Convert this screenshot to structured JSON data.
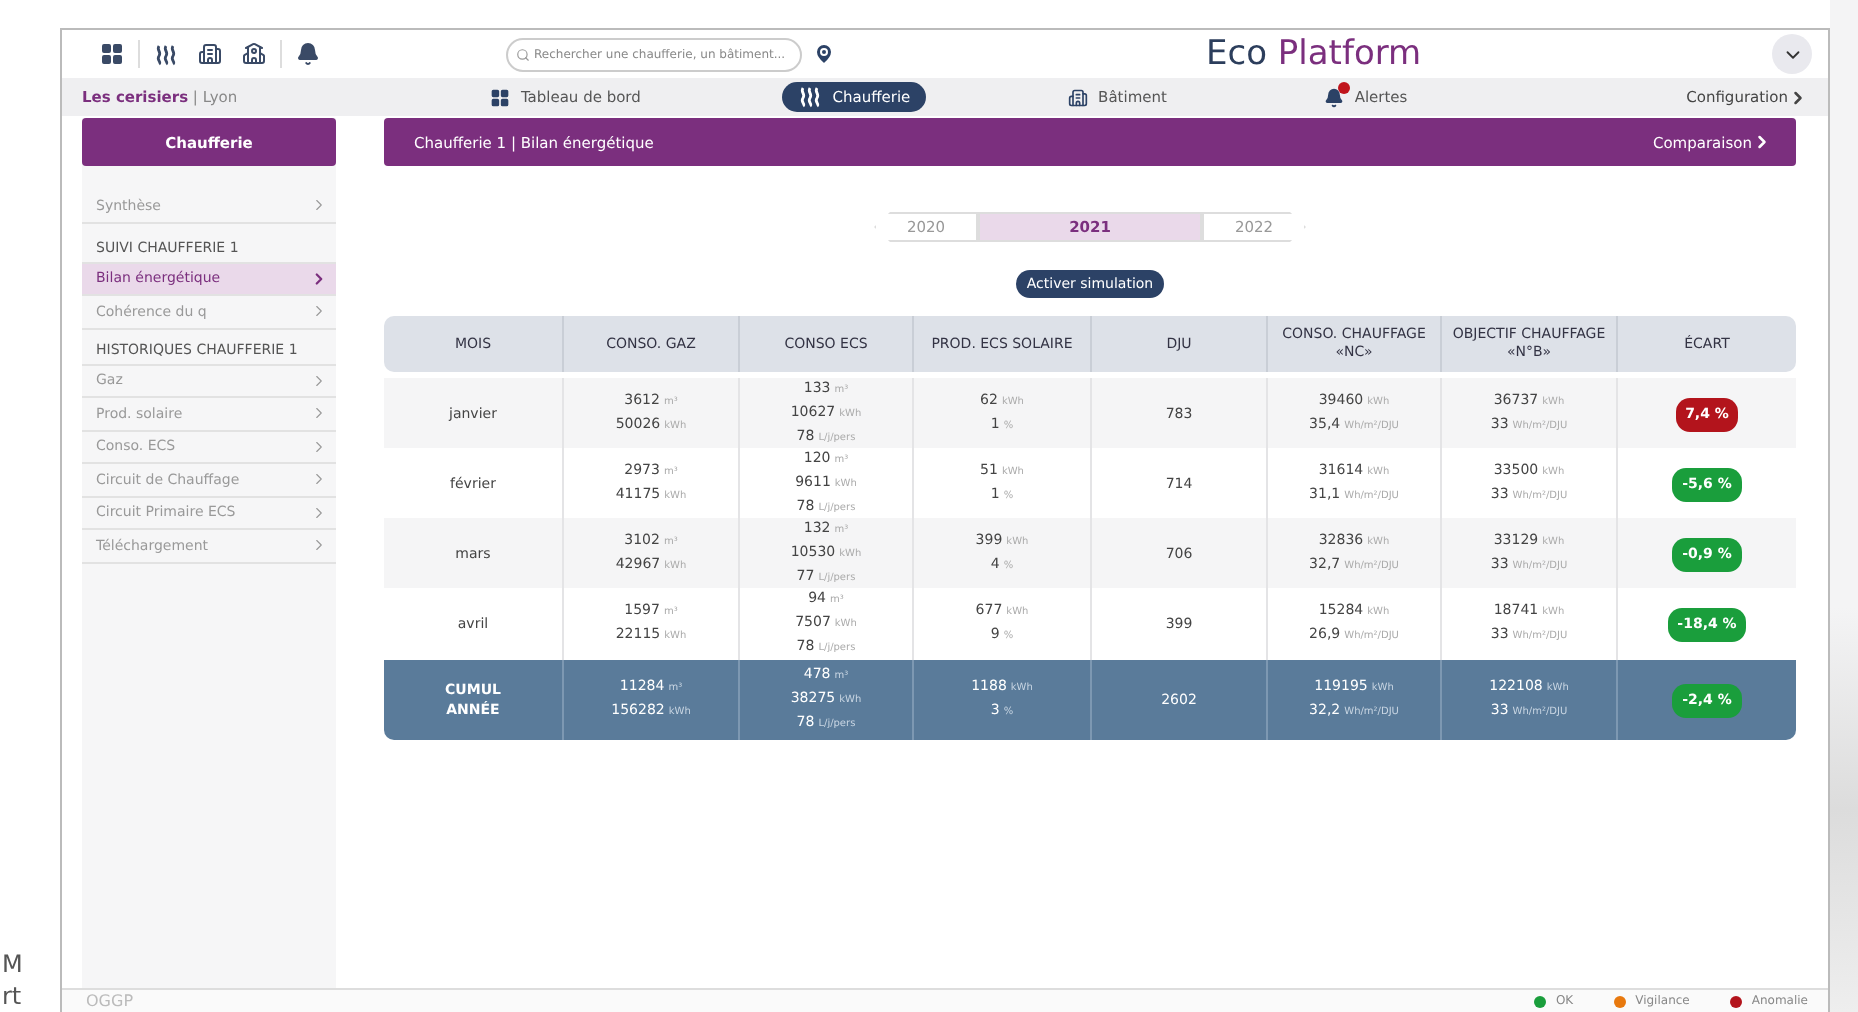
{
  "edge_texts": [
    "M",
    "rt"
  ],
  "header": {
    "search": {
      "placeholder": "Rechercher une chaufferie, un bâtiment..."
    },
    "logo": {
      "part1": "Eco",
      "part2": "Platform"
    }
  },
  "location": "**Les cerisiers** | Lyon",
  "nav": [
    {
      "label": "Tableau de bord",
      "selected": false
    },
    {
      "label": "Chaufferie",
      "selected": true
    },
    {
      "label": "Bâtiment",
      "selected": false
    },
    {
      "label": "Alertes",
      "selected": false
    }
  ],
  "config_link": "Configuration",
  "sidebar": {
    "title": "Chaufferie",
    "items": [
      {
        "kind": "link",
        "label": "Synthèse",
        "selected": false
      },
      {
        "kind": "section",
        "label": "SUIVI CHAUFFERIE 1"
      },
      {
        "kind": "link",
        "label": "Bilan énergétique",
        "selected": true
      },
      {
        "kind": "link",
        "label": "Cohérence du q",
        "selected": false
      },
      {
        "kind": "section",
        "label": "HISTORIQUES CHAUFFERIE 1"
      },
      {
        "kind": "link",
        "label": "Gaz",
        "selected": false
      },
      {
        "kind": "link",
        "label": "Prod. solaire",
        "selected": false
      },
      {
        "kind": "link",
        "label": "Conso. ECS",
        "selected": false
      },
      {
        "kind": "link",
        "label": "Circuit de Chauffage",
        "selected": false
      },
      {
        "kind": "link",
        "label": "Circuit Primaire ECS",
        "selected": false
      },
      {
        "kind": "link",
        "label": "Téléchargement",
        "selected": false
      }
    ]
  },
  "page_title": "Chaufferie 1 | Bilan énergétique",
  "compare_link": "Comparaison",
  "years": [
    {
      "label": "2020",
      "selected": false
    },
    {
      "label": "2021",
      "selected": true
    },
    {
      "label": "2022",
      "selected": false
    }
  ],
  "simulation_button": "Activer simulation",
  "table": {
    "columns": [
      "MOIS",
      "CONSO. GAZ",
      "CONSO ECS",
      "PROD. ECS SOLAIRE",
      "DJU",
      "CONSO. CHAUFFAGE «NC»",
      "OBJECTIF CHAUFFAGE «N°B»",
      "ÉCART"
    ],
    "rows": [
      {
        "kind": "month",
        "color": "#b3141c",
        "cells": [
          [
            [
              "janvier",
              ""
            ]
          ],
          [
            [
              "3612",
              "m³"
            ],
            [
              "50026",
              "kWh"
            ]
          ],
          [
            [
              "133",
              "m³"
            ],
            [
              "10627",
              "kWh"
            ],
            [
              "78",
              "L/j/pers"
            ]
          ],
          [
            [
              "62",
              "kWh"
            ],
            [
              "1",
              "%"
            ]
          ],
          [
            [
              "783",
              ""
            ]
          ],
          [
            [
              "39460",
              "kWh"
            ],
            [
              "35,4",
              "Wh/m²/DJU"
            ]
          ],
          [
            [
              "36737",
              "kWh"
            ],
            [
              "33",
              "Wh/m²/DJU"
            ]
          ],
          [
            [
              "7,4 %",
              ""
            ]
          ]
        ]
      },
      {
        "kind": "month",
        "color": "#1a9e3c",
        "cells": [
          [
            [
              "février",
              ""
            ]
          ],
          [
            [
              "2973",
              "m³"
            ],
            [
              "41175",
              "kWh"
            ]
          ],
          [
            [
              "120",
              "m³"
            ],
            [
              "9611",
              "kWh"
            ],
            [
              "78",
              "L/j/pers"
            ]
          ],
          [
            [
              "51",
              "kWh"
            ],
            [
              "1",
              "%"
            ]
          ],
          [
            [
              "714",
              ""
            ]
          ],
          [
            [
              "31614",
              "kWh"
            ],
            [
              "31,1",
              "Wh/m²/DJU"
            ]
          ],
          [
            [
              "33500",
              "kWh"
            ],
            [
              "33",
              "Wh/m²/DJU"
            ]
          ],
          [
            [
              "-5,6 %",
              ""
            ]
          ]
        ]
      },
      {
        "kind": "month",
        "color": "#1a9e3c",
        "cells": [
          [
            [
              "mars",
              ""
            ]
          ],
          [
            [
              "3102",
              "m³"
            ],
            [
              "42967",
              "kWh"
            ]
          ],
          [
            [
              "132",
              "m³"
            ],
            [
              "10530",
              "kWh"
            ],
            [
              "77",
              "L/j/pers"
            ]
          ],
          [
            [
              "399",
              "kWh"
            ],
            [
              "4",
              "%"
            ]
          ],
          [
            [
              "706",
              ""
            ]
          ],
          [
            [
              "32836",
              "kWh"
            ],
            [
              "32,7",
              "Wh/m²/DJU"
            ]
          ],
          [
            [
              "33129",
              "kWh"
            ],
            [
              "33",
              "Wh/m²/DJU"
            ]
          ],
          [
            [
              "-0,9 %",
              ""
            ]
          ]
        ]
      },
      {
        "kind": "month",
        "color": "#1a9e3c",
        "cells": [
          [
            [
              "avril",
              ""
            ]
          ],
          [
            [
              "1597",
              "m³"
            ],
            [
              "22115",
              "kWh"
            ]
          ],
          [
            [
              "94",
              "m³"
            ],
            [
              "7507",
              "kWh"
            ],
            [
              "78",
              "L/j/pers"
            ]
          ],
          [
            [
              "677",
              "kWh"
            ],
            [
              "9",
              "%"
            ]
          ],
          [
            [
              "399",
              ""
            ]
          ],
          [
            [
              "15284",
              "kWh"
            ],
            [
              "26,9",
              "Wh/m²/DJU"
            ]
          ],
          [
            [
              "18741",
              "kWh"
            ],
            [
              "33",
              "Wh/m²/DJU"
            ]
          ],
          [
            [
              "-18,4 %",
              ""
            ]
          ]
        ]
      },
      {
        "kind": "total",
        "color": "#1a9e3c",
        "cells": [
          [
            [
              "CUMUL ANNÉE",
              ""
            ]
          ],
          [
            [
              "11284",
              "m³"
            ],
            [
              "156282",
              "kWh"
            ]
          ],
          [
            [
              "478",
              "m³"
            ],
            [
              "38275",
              "kWh"
            ],
            [
              "78",
              "L/j/pers"
            ]
          ],
          [
            [
              "1188",
              "kWh"
            ],
            [
              "3",
              "%"
            ]
          ],
          [
            [
              "2602",
              ""
            ]
          ],
          [
            [
              "119195",
              "kWh"
            ],
            [
              "32,2",
              "Wh/m²/DJU"
            ]
          ],
          [
            [
              "122108",
              "kWh"
            ],
            [
              "33",
              "Wh/m²/DJU"
            ]
          ],
          [
            [
              "-2,4 %",
              ""
            ]
          ]
        ]
      }
    ]
  },
  "footer": {
    "brand": "OGGP",
    "legend": [
      {
        "label": "OK",
        "color": "#1a9e3c"
      },
      {
        "label": "Vigilance",
        "color": "#e8790e"
      },
      {
        "label": "Anomalie",
        "color": "#b3141c"
      }
    ]
  }
}
